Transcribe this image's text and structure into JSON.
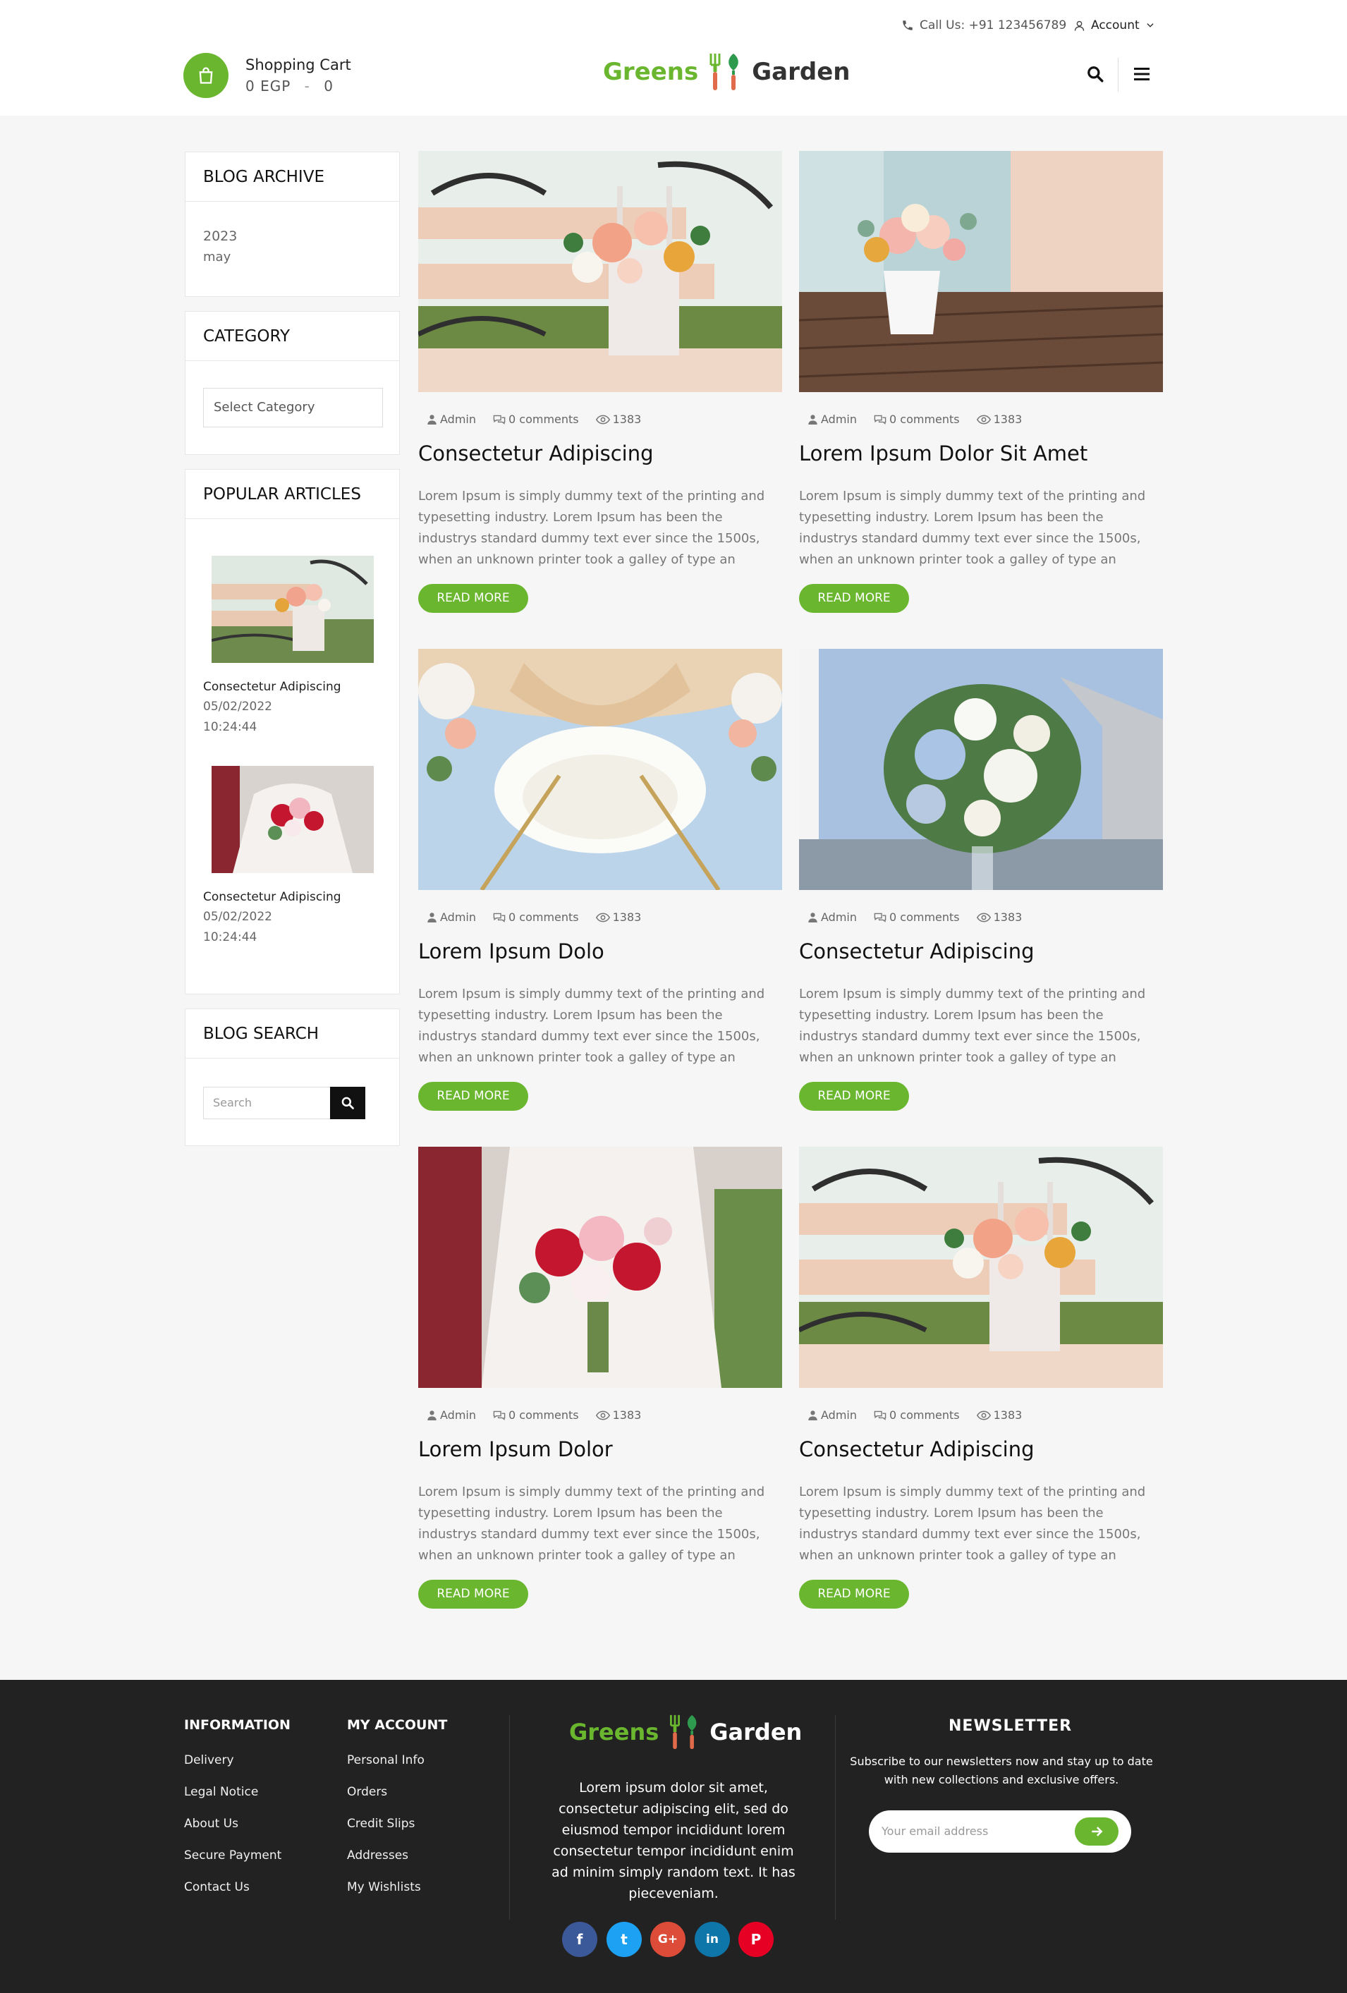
{
  "topbar": {
    "call": "Call Us: +91 123456789",
    "account": "Account"
  },
  "header": {
    "cart_title": "Shopping Cart",
    "cart_amount": "0 EGP",
    "cart_sep": "-",
    "cart_count": "0",
    "logo_word1": "Greens",
    "logo_word2": "Garden"
  },
  "sidebar": {
    "archive": {
      "title": "BLOG ARCHIVE",
      "year": "2023",
      "month": "may"
    },
    "category": {
      "title": "CATEGORY",
      "select_value": "Select Category"
    },
    "popular": {
      "title": "POPULAR ARTICLES",
      "items": [
        {
          "title": "Consectetur Adipiscing",
          "date": "05/02/2022",
          "time": "10:24:44"
        },
        {
          "title": "Consectetur Adipiscing",
          "date": "05/02/2022",
          "time": "10:24:44"
        }
      ]
    },
    "search": {
      "title": "BLOG SEARCH",
      "placeholder": "Search"
    }
  },
  "posts": [
    {
      "author": "Admin",
      "comments": "0 comments",
      "views": "1383",
      "title": "Consectetur Adipiscing",
      "excerpt": "Lorem Ipsum is simply dummy text of the printing and typesetting industry. Lorem Ipsum has been the industrys standard dummy text ever since the 1500s, when an unknown printer took a galley of type an",
      "button": "READ MORE"
    },
    {
      "author": "Admin",
      "comments": "0 comments",
      "views": "1383",
      "title": "Lorem Ipsum Dolor Sit Amet",
      "excerpt": "Lorem Ipsum is simply dummy text of the printing and typesetting industry. Lorem Ipsum has been the industrys standard dummy text ever since the 1500s, when an unknown printer took a galley of type an",
      "button": "READ MORE"
    },
    {
      "author": "Admin",
      "comments": "0 comments",
      "views": "1383",
      "title": "Lorem Ipsum Dolo",
      "excerpt": "Lorem Ipsum is simply dummy text of the printing and typesetting industry. Lorem Ipsum has been the industrys standard dummy text ever since the 1500s, when an unknown printer took a galley of type an",
      "button": "READ MORE"
    },
    {
      "author": "Admin",
      "comments": "0 comments",
      "views": "1383",
      "title": "Consectetur Adipiscing",
      "excerpt": "Lorem Ipsum is simply dummy text of the printing and typesetting industry. Lorem Ipsum has been the industrys standard dummy text ever since the 1500s, when an unknown printer took a galley of type an",
      "button": "READ MORE"
    },
    {
      "author": "Admin",
      "comments": "0 comments",
      "views": "1383",
      "title": "Lorem Ipsum Dolor",
      "excerpt": "Lorem Ipsum is simply dummy text of the printing and typesetting industry. Lorem Ipsum has been the industrys standard dummy text ever since the 1500s, when an unknown printer took a galley of type an",
      "button": "READ MORE"
    },
    {
      "author": "Admin",
      "comments": "0 comments",
      "views": "1383",
      "title": "Consectetur Adipiscing",
      "excerpt": "Lorem Ipsum is simply dummy text of the printing and typesetting industry. Lorem Ipsum has been the industrys standard dummy text ever since the 1500s, when an unknown printer took a galley of type an",
      "button": "READ MORE"
    }
  ],
  "footer": {
    "information": {
      "title": "INFORMATION",
      "links": [
        "Delivery",
        "Legal Notice",
        "About Us",
        "Secure Payment",
        "Contact Us"
      ]
    },
    "my_account": {
      "title": "MY ACCOUNT",
      "links": [
        "Personal Info",
        "Orders",
        "Credit Slips",
        "Addresses",
        "My Wishlists"
      ]
    },
    "logo_word1": "Greens",
    "logo_word2": "Garden",
    "description": "Lorem ipsum dolor sit amet, consectetur adipiscing elit, sed do eiusmod tempor incididunt lorem consectetur tempor incididunt enim ad minim simply random text. It has pieceveniam.",
    "newsletter": {
      "title": "NEWSLETTER",
      "text": "Subscribe to our newsletters now and stay up to date with new collections and exclusive offers.",
      "placeholder": "Your email address"
    },
    "social": [
      {
        "icon": "facebook-icon",
        "glyph": "f",
        "color": "#3b5998"
      },
      {
        "icon": "twitter-icon",
        "glyph": "t",
        "color": "#1da1f2"
      },
      {
        "icon": "google-plus-icon",
        "glyph": "G+",
        "color": "#dd4b39"
      },
      {
        "icon": "linkedin-icon",
        "glyph": "in",
        "color": "#0e76a8"
      },
      {
        "icon": "pinterest-icon",
        "glyph": "P",
        "color": "#e60023"
      }
    ]
  },
  "colors": {
    "accent": "#6ab72f",
    "footer_bg": "#222222",
    "page_bg": "#f6f6f6"
  }
}
